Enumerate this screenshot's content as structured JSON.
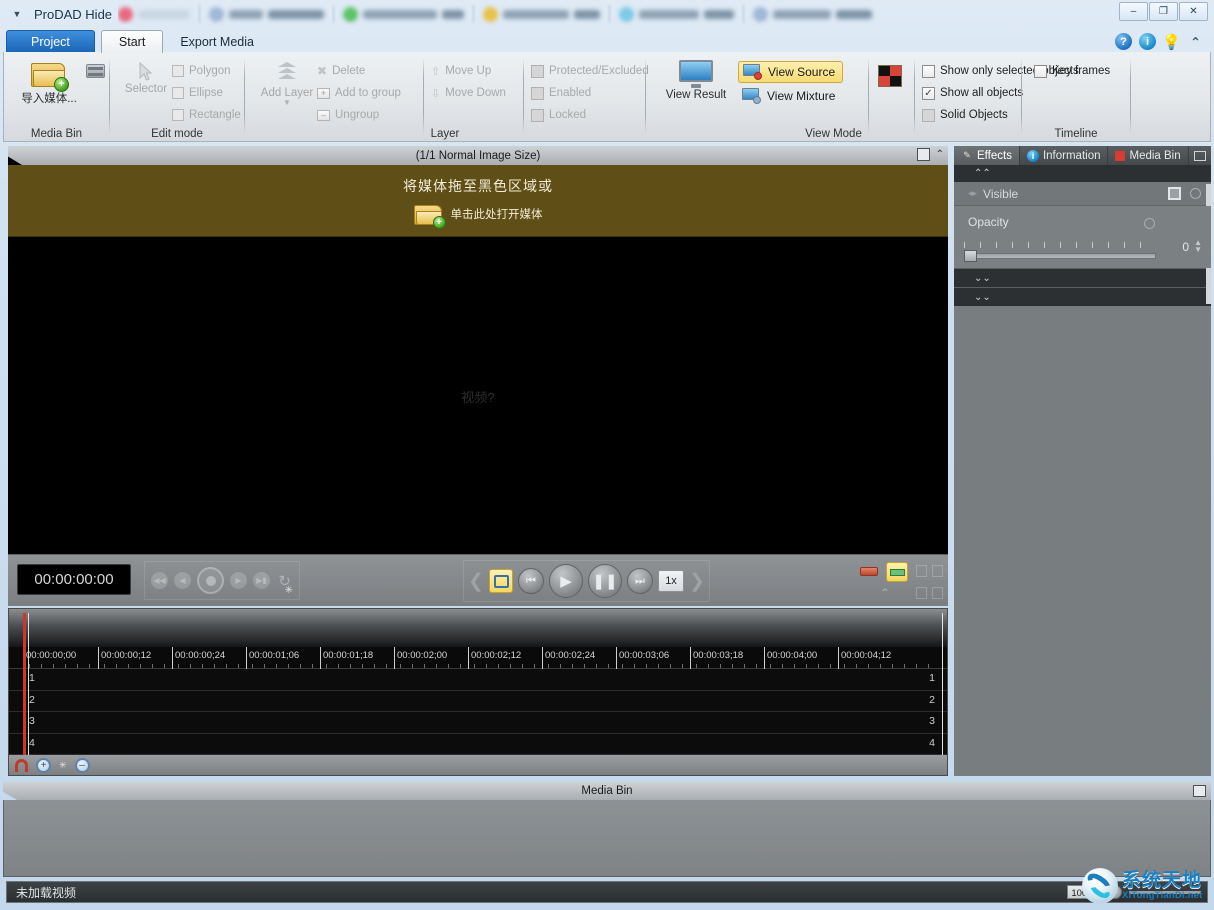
{
  "window": {
    "title": "ProDAD Hide",
    "menu_arrow_icon": "dropdown-arrow-icon",
    "controls": {
      "minimize": "–",
      "restore": "❐",
      "close": "✕"
    }
  },
  "tabs": [
    {
      "label": "Project",
      "state": "primary"
    },
    {
      "label": "Start",
      "state": "active"
    },
    {
      "label": "Export Media",
      "state": "normal"
    }
  ],
  "help_icons": [
    {
      "name": "help-icon",
      "glyph": "?"
    },
    {
      "name": "info-icon",
      "glyph": "i"
    },
    {
      "name": "tip-bulb-icon",
      "glyph": "●"
    },
    {
      "name": "collapse-ribbon-icon",
      "glyph": "⌃"
    }
  ],
  "ribbon": {
    "groups": [
      {
        "label": "Media Bin",
        "import_button": "导入媒体...",
        "film_button_name": "media-browser-icon"
      },
      {
        "label": "Edit mode",
        "selector_label": "Selector",
        "items": [
          "Polygon",
          "Ellipse",
          "Rectangle"
        ]
      },
      {
        "label": "Layer",
        "add_layer_label": "Add Layer",
        "col1": [
          "Delete",
          "Add to group",
          "Ungroup"
        ],
        "col2": [
          "Move Up",
          "Move Down"
        ],
        "col3": [
          "Protected/Excluded",
          "Enabled",
          "Locked"
        ]
      },
      {
        "label": "View Mode",
        "view_result": "View Result",
        "view_source": "View Source",
        "view_mixture": "View Mixture",
        "checkboxes": [
          {
            "label": "Show only selected objects",
            "checked": false
          },
          {
            "label": "Show all objects",
            "checked": true
          },
          {
            "label": "Solid Objects",
            "checked": false
          }
        ]
      },
      {
        "label": "Timeline",
        "keyframes": {
          "label": "Key frames",
          "checked": false
        }
      }
    ]
  },
  "viewer": {
    "header_title": "(1/1  Normal Image Size)",
    "dropzone_title": "将媒体拖至黑色区域或",
    "dropzone_action": "单击此处打开媒体",
    "video_placeholder": "视频?"
  },
  "transport": {
    "timecode": "00:00:00:00",
    "speed": "1x",
    "buttons": {
      "loop": "loop-button",
      "prev": "skip-previous-button",
      "play": "play-button",
      "pause": "pause-button",
      "next": "skip-next-button"
    }
  },
  "timeline": {
    "ruler_labels": [
      "00:00:00;00",
      "00:00:00;12",
      "00:00:00;24",
      "00:00:01;06",
      "00:00:01;18",
      "00:00:02;00",
      "00:00:02;12",
      "00:00:02;24",
      "00:00:03;06",
      "00:00:03;18",
      "00:00:04;00",
      "00:00:04;12"
    ],
    "tracks": [
      "1",
      "2",
      "3",
      "4"
    ],
    "tools": {
      "snap": "magnet-snap-icon",
      "zoom_in": "zoom-in-icon",
      "zoom_out": "zoom-out-icon"
    }
  },
  "right_panel": {
    "tabs": [
      {
        "label": "Effects",
        "icon": "wand-icon",
        "active": true
      },
      {
        "label": "Information",
        "icon": "info-icon",
        "active": false
      },
      {
        "label": "Media Bin",
        "icon": "red-square-icon",
        "active": false
      }
    ],
    "properties": {
      "visible_label": "Visible",
      "opacity_label": "Opacity",
      "opacity_value": "0"
    }
  },
  "media_bin": {
    "title": "Media Bin"
  },
  "status_bar": {
    "message": "未加载视频",
    "zoom": "100％"
  },
  "watermark": {
    "cn": "系统天地",
    "en": "XiTongTianDi.net"
  },
  "colors": {
    "accent_blue": "#1b63b5",
    "highlight_yellow": "#f4d75f",
    "dropzone_olive": "#5f4f16",
    "playhead_red": "#d0342a"
  }
}
